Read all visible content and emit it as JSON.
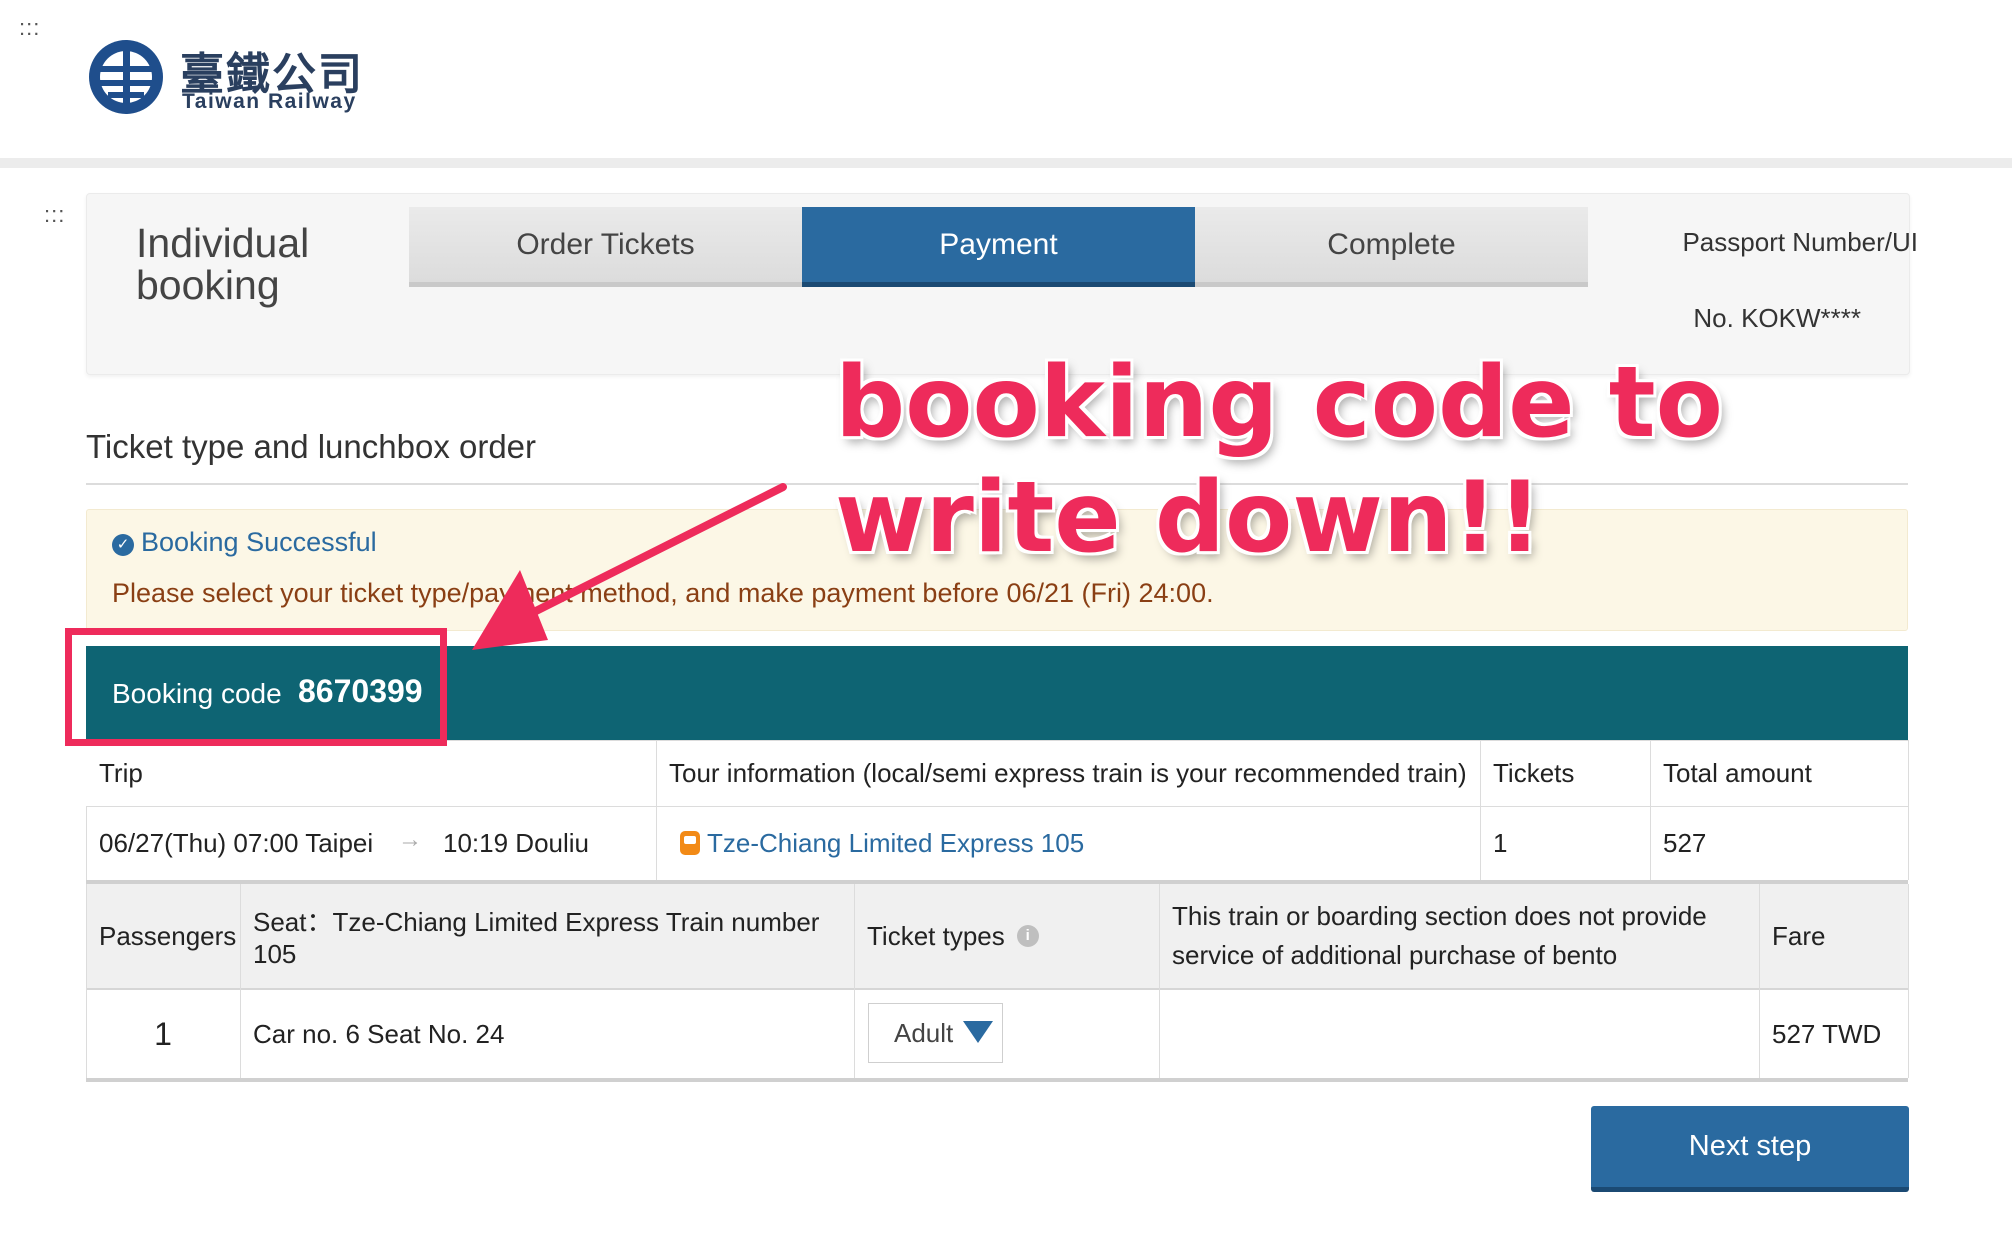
{
  "header": {
    "logo_zh": "臺鐵公司",
    "logo_en": "Taiwan Railway",
    "grip": ":::"
  },
  "booking_panel": {
    "title": "Individual booking",
    "steps": [
      {
        "label": "Order Tickets",
        "active": false
      },
      {
        "label": "Payment",
        "active": true
      },
      {
        "label": "Complete",
        "active": false
      }
    ],
    "passport_line1": "Passport Number/UI",
    "passport_line2": "No.  KOKW****"
  },
  "section_title": "Ticket type and lunchbox order",
  "notice": {
    "title": "Booking Successful",
    "message": "Please select your ticket type/payment method, and make payment before 06/21 (Fri) 24:00."
  },
  "booking_code": {
    "label": "Booking code",
    "value": "8670399"
  },
  "trip_table": {
    "headers": [
      "Trip",
      "Tour information (local/semi express train is your recommended train)",
      "Tickets",
      "Total amount"
    ],
    "row": {
      "trip": "06/27(Thu)  07:00  Taipei",
      "arrow": "→",
      "arrival": "10:19  Douliu",
      "train": "Tze-Chiang Limited Express 105",
      "tickets": "1",
      "total": "527"
    }
  },
  "passenger_table": {
    "headers": [
      "Passengers",
      "Seat：Tze-Chiang Limited Express Train number 105",
      "Ticket types",
      "This train or boarding section does not provide service of additional purchase of bento",
      "Fare"
    ],
    "row": {
      "passenger": "1",
      "seat": "Car no. 6 Seat No. 24",
      "ticket_type": "Adult",
      "bento": "",
      "fare": "527 TWD"
    }
  },
  "next_button": "Next step",
  "annotation": {
    "text": "booking code to write down!!",
    "color": "#ee2b5b"
  },
  "colors": {
    "primary": "#2a6aa0",
    "teal": "#0e6473",
    "notice_bg": "#fcf7e6"
  }
}
